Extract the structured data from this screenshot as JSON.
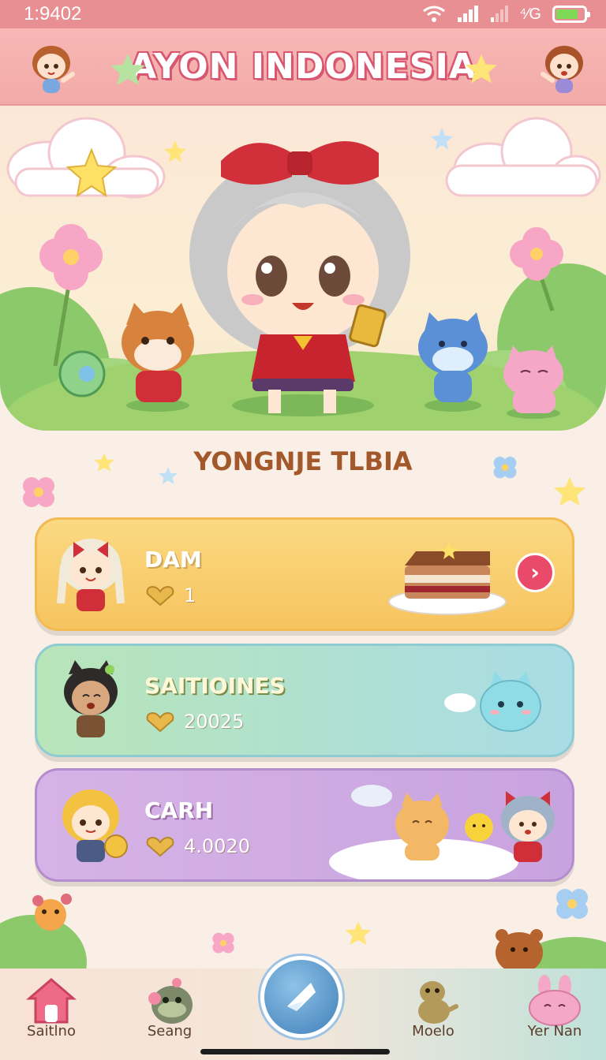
{
  "status_bar": {
    "time": "1:9402",
    "indicator": "⁴⁄G"
  },
  "header": {
    "title": "AYON INDONESIA"
  },
  "section": {
    "title": "YONGNJE TLBIA"
  },
  "cards": [
    {
      "name": "DAM",
      "stat": "1",
      "color": "#f6c45f",
      "arrow": "›"
    },
    {
      "name": "SAITIOINES",
      "stat": "20025",
      "color": "#a9dce6"
    },
    {
      "name": "CARH",
      "stat": "4.0020",
      "color": "#c8a3df"
    }
  ],
  "nav": {
    "items": [
      {
        "label": "Saitlno",
        "icon": "home-icon"
      },
      {
        "label": "Seang",
        "icon": "monster-icon"
      },
      {
        "label": "Moelo",
        "icon": "dino-icon"
      },
      {
        "label": "Yer Nan",
        "icon": "bunny-icon"
      }
    ],
    "center_icon": "compass-icon"
  },
  "colors": {
    "accent_pink": "#e94a6a",
    "title_brown": "#a3582b",
    "header_bg": "#f7b7b5"
  }
}
